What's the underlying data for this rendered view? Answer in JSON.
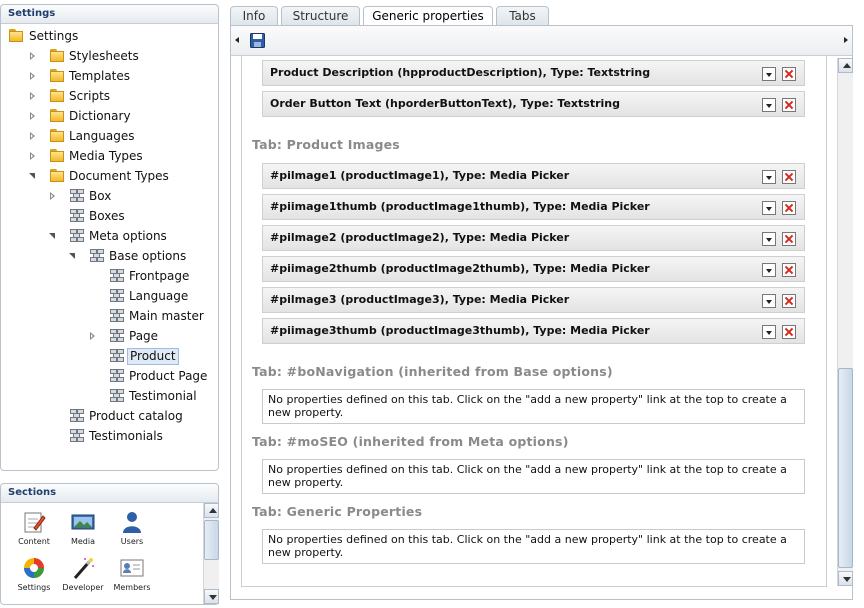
{
  "settings": {
    "title": "Settings",
    "tree": [
      {
        "label": "Settings",
        "type": "folder",
        "arrow": "none",
        "depth": 0
      },
      {
        "label": "Stylesheets",
        "type": "folder",
        "arrow": "closed",
        "depth": 1
      },
      {
        "label": "Templates",
        "type": "folder",
        "arrow": "closed",
        "depth": 1
      },
      {
        "label": "Scripts",
        "type": "folder",
        "arrow": "closed",
        "depth": 1
      },
      {
        "label": "Dictionary",
        "type": "folder",
        "arrow": "closed",
        "depth": 1
      },
      {
        "label": "Languages",
        "type": "folder",
        "arrow": "closed",
        "depth": 1
      },
      {
        "label": "Media Types",
        "type": "folder",
        "arrow": "closed",
        "depth": 1
      },
      {
        "label": "Document Types",
        "type": "folder",
        "arrow": "open",
        "depth": 1
      },
      {
        "label": "Box",
        "type": "doctype",
        "arrow": "closed",
        "depth": 2
      },
      {
        "label": "Boxes",
        "type": "doctype",
        "arrow": "none",
        "depth": 2
      },
      {
        "label": "Meta options",
        "type": "doctype",
        "arrow": "open",
        "depth": 2
      },
      {
        "label": "Base options",
        "type": "doctype",
        "arrow": "open",
        "depth": 3
      },
      {
        "label": "Frontpage",
        "type": "doctype",
        "arrow": "none",
        "depth": 4
      },
      {
        "label": "Language",
        "type": "doctype",
        "arrow": "none",
        "depth": 4
      },
      {
        "label": "Main master",
        "type": "doctype",
        "arrow": "none",
        "depth": 4
      },
      {
        "label": "Page",
        "type": "doctype",
        "arrow": "closed",
        "depth": 4
      },
      {
        "label": "Product",
        "type": "doctype",
        "arrow": "none",
        "depth": 4,
        "selected": true
      },
      {
        "label": "Product Page",
        "type": "doctype",
        "arrow": "none",
        "depth": 4
      },
      {
        "label": "Testimonial",
        "type": "doctype",
        "arrow": "none",
        "depth": 4
      },
      {
        "label": "Product catalog",
        "type": "doctype",
        "arrow": "none",
        "depth": 2
      },
      {
        "label": "Testimonials",
        "type": "doctype",
        "arrow": "none",
        "depth": 2
      }
    ]
  },
  "sections": {
    "title": "Sections",
    "items": [
      {
        "label": "Content",
        "icon": "content-icon"
      },
      {
        "label": "Media",
        "icon": "media-icon"
      },
      {
        "label": "Users",
        "icon": "users-icon"
      },
      {
        "label": "Settings",
        "icon": "settings-icon"
      },
      {
        "label": "Developer",
        "icon": "developer-icon"
      },
      {
        "label": "Members",
        "icon": "members-icon"
      }
    ]
  },
  "tabs": [
    "Info",
    "Structure",
    "Generic properties",
    "Tabs"
  ],
  "active_tab": "Generic properties",
  "properties_top": [
    "Product Description (hpproductDescription), Type: Textstring",
    "Order Button Text (hporderButtonText), Type: Textstring"
  ],
  "groups": [
    {
      "title": "Tab: Product Images",
      "props": [
        "#pilmage1 (productImage1), Type: Media Picker",
        "#piimage1thumb (productImage1thumb), Type: Media Picker",
        "#pilmage2 (productImage2), Type: Media Picker",
        "#piimage2thumb (productImage2thumb), Type: Media Picker",
        "#pilmage3 (productImage3), Type: Media Picker",
        "#piimage3thumb (productImage3thumb), Type: Media Picker"
      ]
    },
    {
      "title": "Tab: #boNavigation (inherited from Base options)",
      "empty": "No properties defined on this tab. Click on the \"add a new property\" link at the top to create a new property."
    },
    {
      "title": "Tab: #moSEO (inherited from Meta options)",
      "empty": "No properties defined on this tab. Click on the \"add a new property\" link at the top to create a new property."
    },
    {
      "title": "Tab: Generic Properties",
      "empty": "No properties defined on this tab. Click on the \"add a new property\" link at the top to create a new property."
    }
  ],
  "colors": {
    "accent": "#1e3f6b",
    "selected_bg": "#dfeaf7",
    "delete_red": "#d42b1e"
  }
}
